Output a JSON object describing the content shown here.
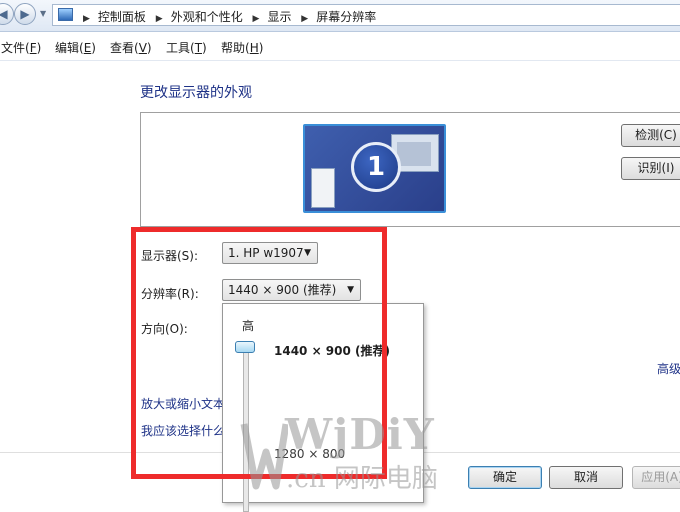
{
  "address_bar": {
    "breadcrumbs": [
      "控制面板",
      "外观和个性化",
      "显示",
      "屏幕分辨率"
    ]
  },
  "menu": {
    "items": [
      {
        "label": "文件(",
        "key": "F",
        "end": ")"
      },
      {
        "label": "编辑(",
        "key": "E",
        "end": ")"
      },
      {
        "label": "查看(",
        "key": "V",
        "end": ")"
      },
      {
        "label": "工具(",
        "key": "T",
        "end": ")"
      },
      {
        "label": "帮助(",
        "key": "H",
        "end": ")"
      }
    ]
  },
  "main": {
    "title": "更改显示器的外观",
    "monitor_number": "1",
    "detect_button": "检测(C)",
    "identify_button": "识别(I)",
    "display_label": "显示器(S):",
    "display_value": "1. HP w1907",
    "resolution_label": "分辨率(R):",
    "resolution_value": "1440 × 900 (推荐)",
    "orientation_label": "方向(O):",
    "advanced_link": "高级",
    "link_text_size": "放大或缩小文本",
    "link_help": "我应该选择什么"
  },
  "resolution_popup": {
    "high_label": "高",
    "current_option": "1440 × 900 (推荐)",
    "lower_option": "1280 × 800",
    "slider_position_percent": 0
  },
  "footer": {
    "ok_button": "确定",
    "cancel_button": "取消",
    "apply_button": "应用(A)"
  },
  "watermark": {
    "brand": "WjDiY",
    "domain": ".cn",
    "tagline": "网际电脑"
  },
  "colors": {
    "highlight_box": "#ee2b2b",
    "title_blue": "#1e3287",
    "monitor_blue": "#3a8fd8"
  }
}
